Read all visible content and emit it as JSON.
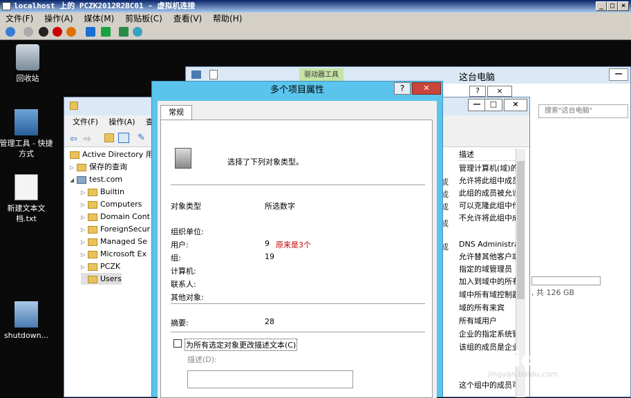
{
  "vm": {
    "title": "localhost 上的 PCZK2012R2BC01 - 虚拟机连接",
    "menu": [
      "文件(F)",
      "操作(A)",
      "媒体(M)",
      "剪贴板(C)",
      "查看(V)",
      "帮助(H)"
    ]
  },
  "desktop": {
    "icons": [
      {
        "label": "回收站",
        "icon": "recycle-bin-icon"
      },
      {
        "label": "管理工具 - 快捷方式",
        "icon": "admin-tools-icon"
      },
      {
        "label": "新建文本文档.txt",
        "icon": "text-file-icon"
      },
      {
        "label": "shutdown...",
        "icon": "shutdown-icon"
      }
    ]
  },
  "pc_window": {
    "ribbon_tag": "驱动器工具",
    "title": "这台电脑",
    "search_placeholder": "搜索\"这台电脑\"",
    "storage_text": ", 共 126 GB"
  },
  "ad_window": {
    "menu": [
      "文件(F)",
      "操作(A)",
      "查看"
    ],
    "tree": [
      {
        "label": "Active Directory 用户",
        "level": 0,
        "expand": ""
      },
      {
        "label": "保存的查询",
        "level": 1,
        "expand": "▷"
      },
      {
        "label": "test.com",
        "level": 1,
        "expand": "◢"
      },
      {
        "label": "Builtin",
        "level": 2,
        "expand": "▷"
      },
      {
        "label": "Computers",
        "level": 2,
        "expand": "▷"
      },
      {
        "label": "Domain Cont",
        "level": 2,
        "expand": "▷"
      },
      {
        "label": "ForeignSecur",
        "level": 2,
        "expand": "▷"
      },
      {
        "label": "Managed Se",
        "level": 2,
        "expand": "▷"
      },
      {
        "label": "Microsoft Ex",
        "level": 2,
        "expand": "▷"
      },
      {
        "label": "PCZK",
        "level": 2,
        "expand": "▷"
      },
      {
        "label": "Users",
        "level": 2,
        "expand": ""
      }
    ],
    "list_header": "描述",
    "descriptions": [
      "管理计算机(域)的",
      "允许将此组中成员",
      "此组的成员被允许",
      "可以克隆此组中作",
      "不允许将此组中成",
      "",
      "DNS Administrat",
      "允许替其他客户端",
      "指定的域管理员",
      "加入到域中的所有",
      "域中所有域控制器",
      "域的所有来宾",
      "所有域用户",
      "企业的指定系统管",
      "该组的成员是企业",
      "",
      "",
      "这个组中的成员可"
    ],
    "left_marks": [
      "戓",
      "成",
      "成",
      "成",
      "成"
    ]
  },
  "dialog": {
    "title": "多个项目属性",
    "help": "?",
    "close": "✕",
    "tab": "常规",
    "heading": "选择了下列对象类型。",
    "col_type": "对象类型",
    "col_count": "所选数字",
    "rows": [
      {
        "label": "组织单位:",
        "value": ""
      },
      {
        "label": "用户:",
        "value": "9"
      },
      {
        "label": "组:",
        "value": "19"
      },
      {
        "label": "计算机:",
        "value": ""
      },
      {
        "label": "联系人:",
        "value": ""
      },
      {
        "label": "其他对象:",
        "value": ""
      }
    ],
    "annotation": "原来是3个",
    "annotation_color": "#c00000",
    "summary_label": "摘要:",
    "summary_value": "28",
    "checkbox_label": "为所有选定对象更改描述文本(C)",
    "desc_label": "描述(D):",
    "desc_value": ""
  },
  "watermark": {
    "text": "Baidu 经验",
    "sub": "jingyan.baidu.com"
  }
}
